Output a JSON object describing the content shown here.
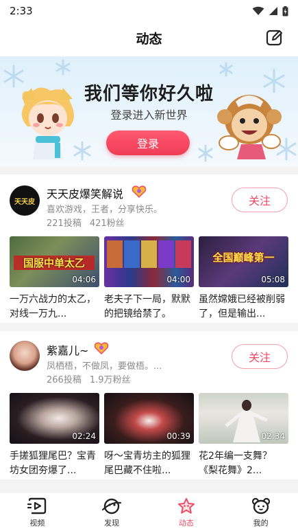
{
  "status": {
    "time": "2:33",
    "icons": [
      "wifi-icon",
      "signal-icon",
      "battery-charging-icon"
    ]
  },
  "header": {
    "title": "动态",
    "edit_icon": "edit-icon"
  },
  "banner": {
    "title": "我们等你好久啦",
    "subtitle": "登录进入新世界",
    "login_label": "登录"
  },
  "colors": {
    "accent": "#ef4a63",
    "login_button": "#f03c56",
    "muted_text": "#8a8a8a"
  },
  "feed": [
    {
      "name": "天天皮爆笑解说",
      "avatar_text": "天天皮",
      "badge_icon": "vip-heart-icon",
      "desc": "喜欢游戏，王者，分享快乐。",
      "posts": "221投稿",
      "fans": "421粉丝",
      "follow_label": "关注",
      "videos": [
        {
          "caption": "国服中单太乙",
          "duration": "04:06",
          "title": "一万六战力的太乙，对线一万九..."
        },
        {
          "caption": "",
          "duration": "04:00",
          "title": "老夫子下一局，默默的把镜给禁了。"
        },
        {
          "caption": "全国巅峰第一",
          "duration": "05:08",
          "title": "虽然嫦娥已经被削弱了，但是输出..."
        }
      ]
    },
    {
      "name": "紫嘉儿~",
      "badge_icon": "vip-heart-icon",
      "desc": "凤栖梧，不做凤，要做梧。...",
      "posts": "266投稿",
      "fans": "1.9万粉丝",
      "follow_label": "关注",
      "videos": [
        {
          "caption": "",
          "duration": "02:24",
          "title": "手搓狐狸尾巴？宝青坊女团夯爆了..."
        },
        {
          "caption": "",
          "duration": "00:39",
          "title": "呀～宝青坊主的狐狸尾巴藏不住啦..."
        },
        {
          "caption": "",
          "duration": "02:34",
          "title": "花2年编一支舞？《梨花舞》2..."
        }
      ]
    }
  ],
  "tabs": [
    {
      "label": "视频",
      "icon": "video-play-icon",
      "active": false
    },
    {
      "label": "发现",
      "icon": "planet-icon",
      "active": false
    },
    {
      "label": "动态",
      "icon": "star-icon",
      "active": true
    },
    {
      "label": "我的",
      "icon": "bear-face-icon",
      "active": false
    }
  ]
}
